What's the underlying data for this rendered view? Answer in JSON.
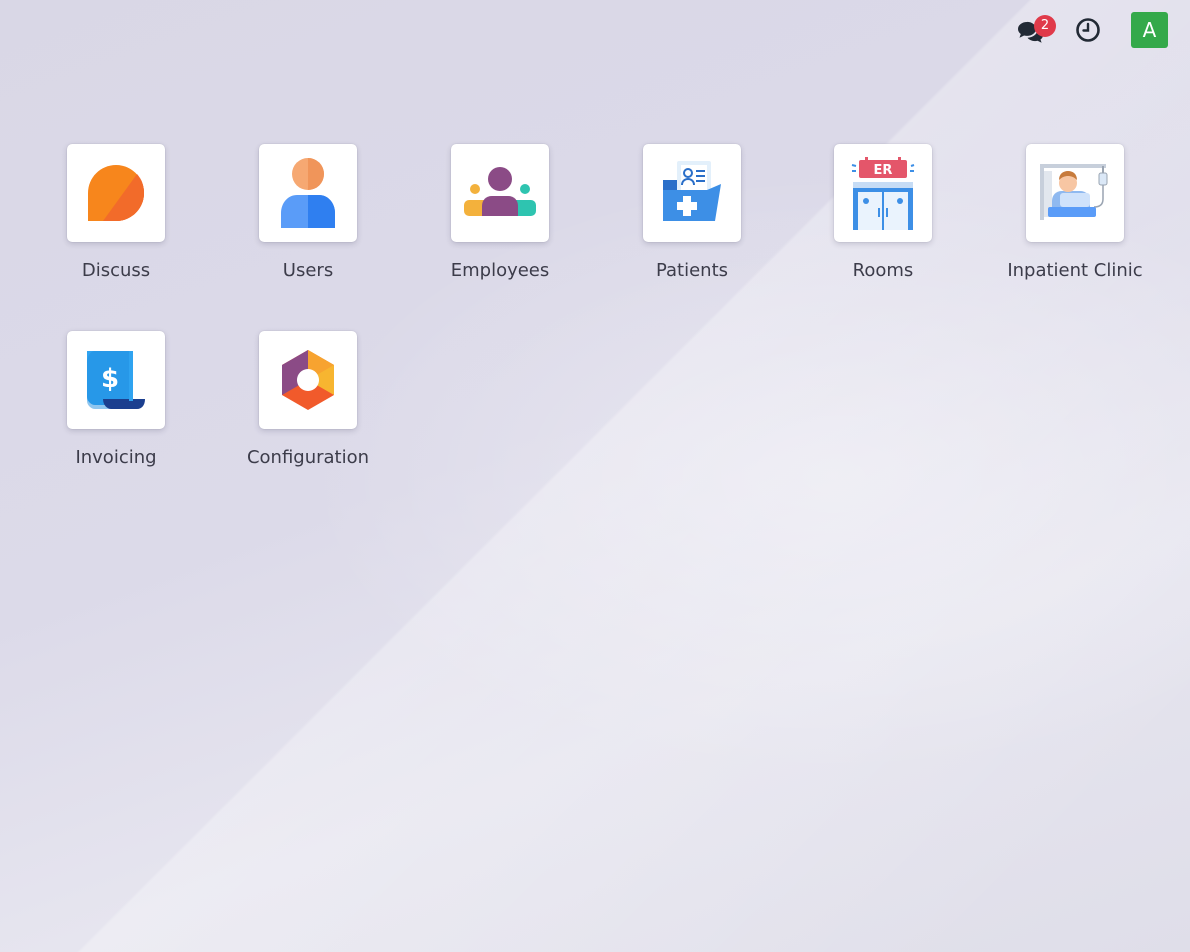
{
  "topbar": {
    "chat_icon": "chat-bubbles-icon",
    "chat_badge": "2",
    "clock_icon": "clock-icon",
    "avatar_letter": "A",
    "avatar_color": "#34a94a",
    "badge_color": "#e03a4a"
  },
  "apps": [
    {
      "label": "Discuss",
      "icon": "discuss-icon"
    },
    {
      "label": "Users",
      "icon": "users-icon"
    },
    {
      "label": "Employees",
      "icon": "employees-icon"
    },
    {
      "label": "Patients",
      "icon": "patients-icon"
    },
    {
      "label": "Rooms",
      "icon": "rooms-icon"
    },
    {
      "label": "Inpatient Clinic",
      "icon": "inpatient-clinic-icon"
    },
    {
      "label": "Invoicing",
      "icon": "invoicing-icon"
    },
    {
      "label": "Configuration",
      "icon": "configuration-icon"
    }
  ],
  "rooms_sign_text": "ER"
}
